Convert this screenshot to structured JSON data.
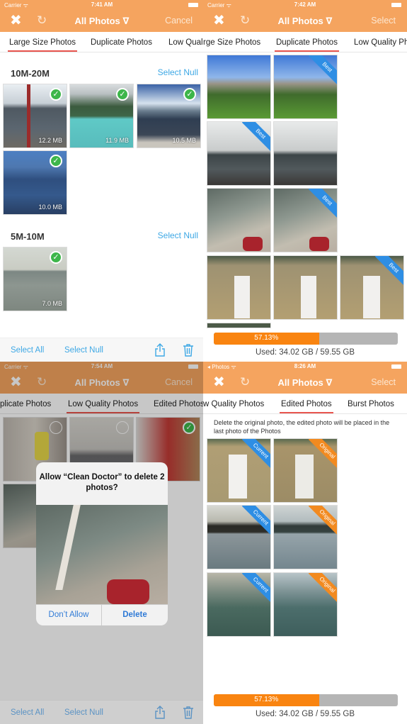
{
  "colors": {
    "header": "#f5a45f",
    "accent_blue": "#3ea8e5",
    "tab_underline": "#e8554e",
    "progress_fill": "#f98410",
    "ribbon_best": "#2e8ee4",
    "ribbon_original": "#f28a20"
  },
  "panel1": {
    "status": {
      "carrier": "Carrier ᯤ",
      "time": "7:41 AM"
    },
    "nav": {
      "close_icon": "✖",
      "refresh_icon": "↻",
      "title": "All Photos ∇",
      "action": "Cancel"
    },
    "tabs": [
      "Large Size Photos",
      "Duplicate Photos",
      "Low Quali"
    ],
    "active_tab": 0,
    "sections": [
      {
        "label": "10M-20M",
        "select": "Select Null",
        "photos": [
          {
            "size": "12.2 MB",
            "selected": true
          },
          {
            "size": "11.9 MB",
            "selected": true
          },
          {
            "size": "10.5 MB",
            "selected": true
          },
          {
            "size": "10.0 MB",
            "selected": true
          }
        ]
      },
      {
        "label": "5M-10M",
        "select": "Select Null",
        "photos": [
          {
            "size": "7.0 MB",
            "selected": true
          }
        ]
      }
    ],
    "bottom": {
      "select_all": "Select All",
      "select_null": "Select Null"
    }
  },
  "panel2": {
    "status": {
      "carrier": "Carrier ᯤ",
      "time": "7:42 AM"
    },
    "nav": {
      "close_icon": "✖",
      "refresh_icon": "↻",
      "title": "All Photos ∇",
      "action": "Select"
    },
    "tabs": [
      "rge Size Photos",
      "Duplicate Photos",
      "Low Quality Pho"
    ],
    "active_tab": 1,
    "ribbon_label": "Best",
    "storage": {
      "percent_label": "57.13%",
      "percent": 57.13,
      "used": "Used: 34.02 GB / 59.55 GB"
    }
  },
  "panel3": {
    "status": {
      "carrier": "Carrier ᯤ",
      "time": "7:54 AM"
    },
    "nav": {
      "close_icon": "✖",
      "refresh_icon": "↻",
      "title": "All Photos ∇",
      "action": "Cancel"
    },
    "tabs": [
      "plicate Photos",
      "Low Quality Photos",
      "Edited Photos"
    ],
    "active_tab": 1,
    "alert": {
      "message": "Allow “Clean Doctor” to delete 2 photos?",
      "dont_allow": "Don’t Allow",
      "delete": "Delete"
    },
    "bottom": {
      "select_all": "Select All",
      "select_null": "Select Null"
    }
  },
  "panel4": {
    "status": {
      "carrier": "◂ Photos ᯤ",
      "time": "8:26 AM"
    },
    "nav": {
      "close_icon": "✖",
      "refresh_icon": "↻",
      "title": "All Photos ∇",
      "action": "Select"
    },
    "tabs": [
      "w Quality Photos",
      "Edited Photos",
      "Burst Photos"
    ],
    "active_tab": 1,
    "note": "Delete the original photo, the edited photo will be placed in the last photo of the Photos",
    "ribbon_current": "Current",
    "ribbon_original": "Original",
    "storage": {
      "percent_label": "57.13%",
      "percent": 57.13,
      "used": "Used: 34.02 GB / 59.55 GB"
    }
  }
}
